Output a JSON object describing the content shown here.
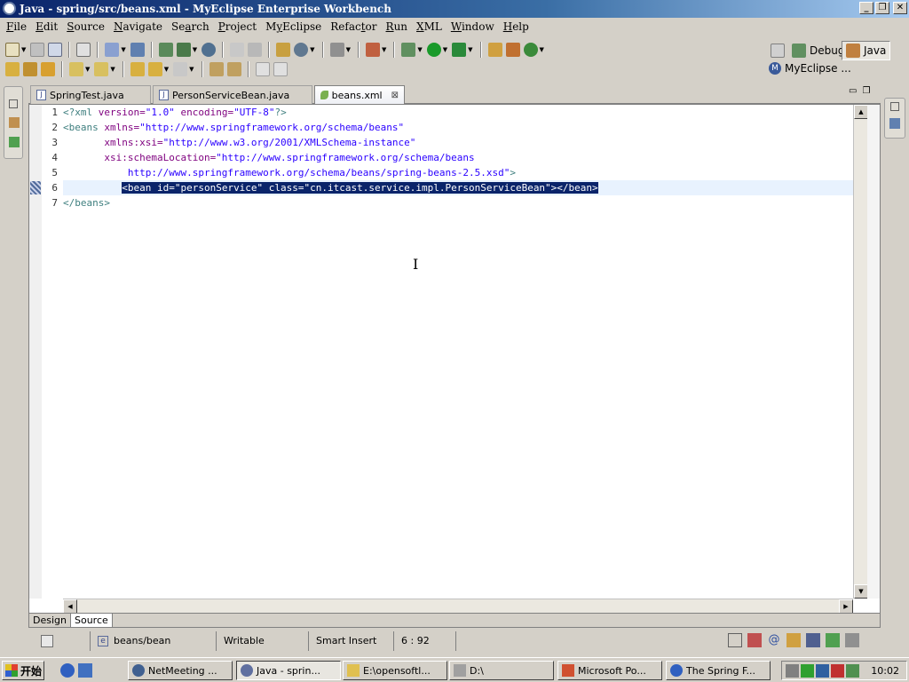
{
  "window": {
    "title": "Java - spring/src/beans.xml - MyEclipse Enterprise Workbench"
  },
  "menu": [
    {
      "label": "File",
      "u": "F"
    },
    {
      "label": "Edit",
      "u": "E"
    },
    {
      "label": "Source",
      "u": "S"
    },
    {
      "label": "Navigate",
      "u": "N"
    },
    {
      "label": "Search",
      "u": "a"
    },
    {
      "label": "Project",
      "u": "P"
    },
    {
      "label": "MyEclipse",
      "u": "y"
    },
    {
      "label": "Refactor",
      "u": "t"
    },
    {
      "label": "Run",
      "u": "R"
    },
    {
      "label": "XML",
      "u": "X"
    },
    {
      "label": "Window",
      "u": "W"
    },
    {
      "label": "Help",
      "u": "H"
    }
  ],
  "perspectives": {
    "debug": "Debug",
    "java": "Java",
    "myeclipse": "MyEclipse ..."
  },
  "tabs": [
    {
      "label": "SpringTest.java"
    },
    {
      "label": "PersonServiceBean.java"
    },
    {
      "label": "beans.xml"
    }
  ],
  "editor": {
    "line_numbers": [
      "1",
      "2",
      "3",
      "4",
      "5",
      "6",
      "7"
    ],
    "lines": [
      [
        {
          "t": "<?xml ",
          "c": "pi"
        },
        {
          "t": "version=",
          "c": "an"
        },
        {
          "t": "\"1.0\"",
          "c": "av"
        },
        {
          "t": " encoding=",
          "c": "an"
        },
        {
          "t": "\"UTF-8\"",
          "c": "av"
        },
        {
          "t": "?>",
          "c": "pi"
        }
      ],
      [
        {
          "t": "<beans ",
          "c": "tg"
        },
        {
          "t": "xmlns=",
          "c": "an"
        },
        {
          "t": "\"http://www.springframework.org/schema/beans\"",
          "c": "av"
        }
      ],
      [
        {
          "t": "       xmlns:xsi=",
          "c": "an"
        },
        {
          "t": "\"http://www.w3.org/2001/XMLSchema-instance\"",
          "c": "av"
        }
      ],
      [
        {
          "t": "       xsi:schemaLocation=",
          "c": "an"
        },
        {
          "t": "\"http://www.springframework.org/schema/beans",
          "c": "av"
        }
      ],
      [
        {
          "t": "           http://www.springframework.org/schema/beans/spring-beans-2.5.xsd\"",
          "c": "av"
        },
        {
          "t": ">",
          "c": "tg"
        }
      ],
      [
        {
          "t": "          ",
          "c": ""
        },
        {
          "t": "<bean id=\"personService\" class=\"cn.itcast.service.impl.PersonServiceBean\"></bean>",
          "c": "sel"
        }
      ],
      [
        {
          "t": "</beans>",
          "c": "tg"
        }
      ]
    ],
    "design_tab": "Design",
    "source_tab": "Source"
  },
  "status": {
    "breadcrumb": "beans/bean",
    "writable": "Writable",
    "insert_mode": "Smart Insert",
    "position": "6 : 92"
  },
  "taskbar": {
    "start": "开始",
    "tasks": [
      {
        "label": "NetMeeting ..."
      },
      {
        "label": "Java - sprin..."
      },
      {
        "label": "E:\\opensoftl..."
      },
      {
        "label": "D:\\"
      },
      {
        "label": "Microsoft Po..."
      },
      {
        "label": "The Spring F..."
      }
    ],
    "clock": "10:02"
  }
}
